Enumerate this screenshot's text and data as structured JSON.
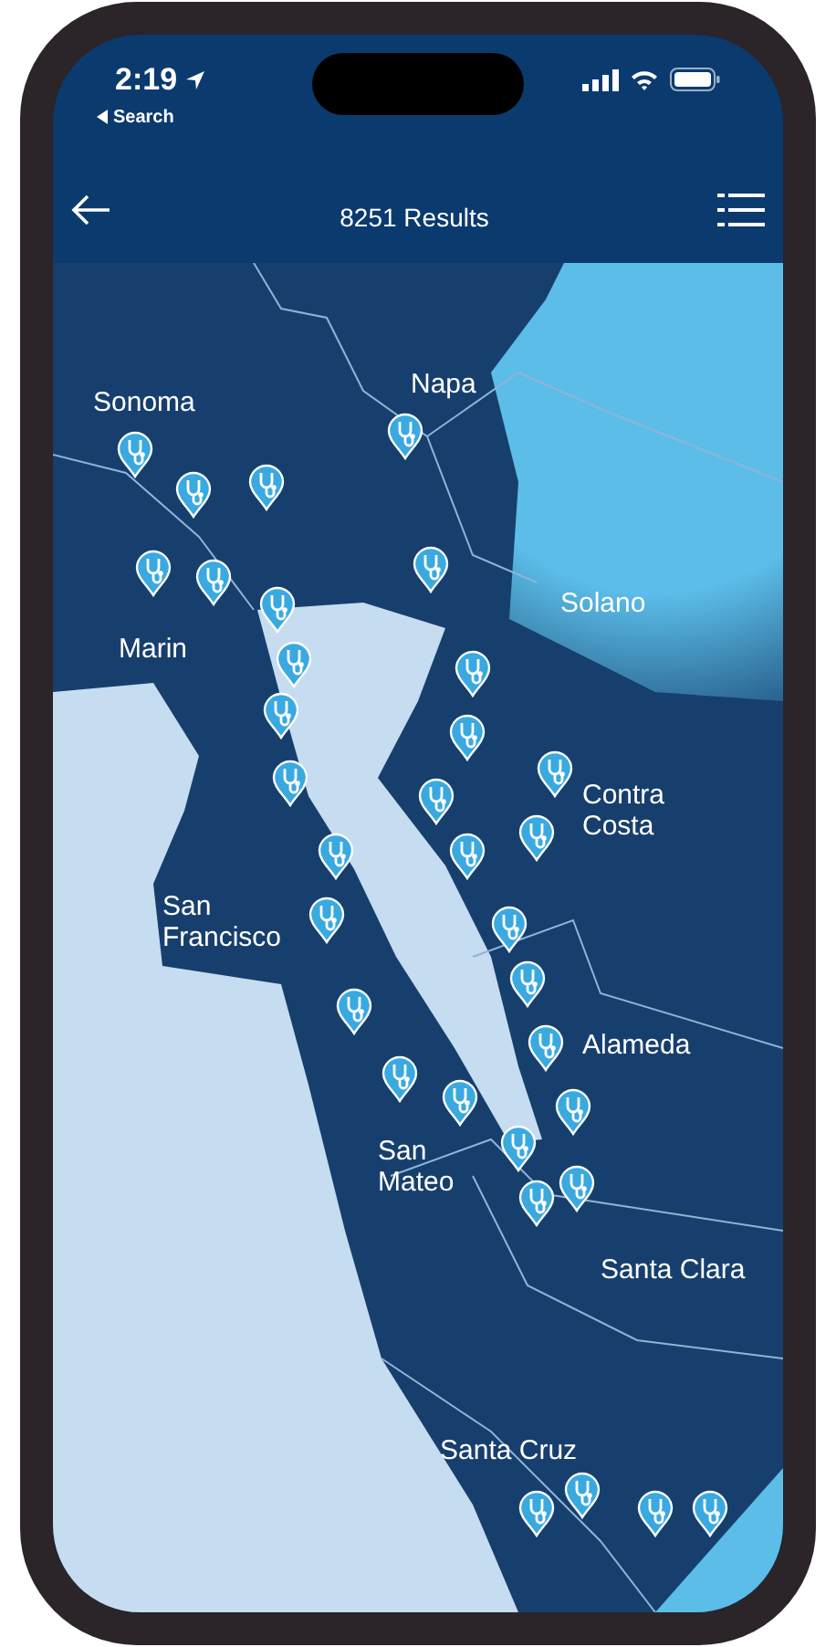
{
  "status_bar": {
    "time": "2:19",
    "back_label": "Search"
  },
  "header": {
    "title": "8251 Results"
  },
  "map": {
    "regions": [
      {
        "label": "Sonoma"
      },
      {
        "label": "Napa"
      },
      {
        "label": "Solano"
      },
      {
        "label": "Marin"
      },
      {
        "label": "Contra Costa"
      },
      {
        "label": "San Francisco"
      },
      {
        "label": "Alameda"
      },
      {
        "label": "San Mateo"
      },
      {
        "label": "Santa Clara"
      },
      {
        "label": "Santa Cruz"
      }
    ]
  }
}
